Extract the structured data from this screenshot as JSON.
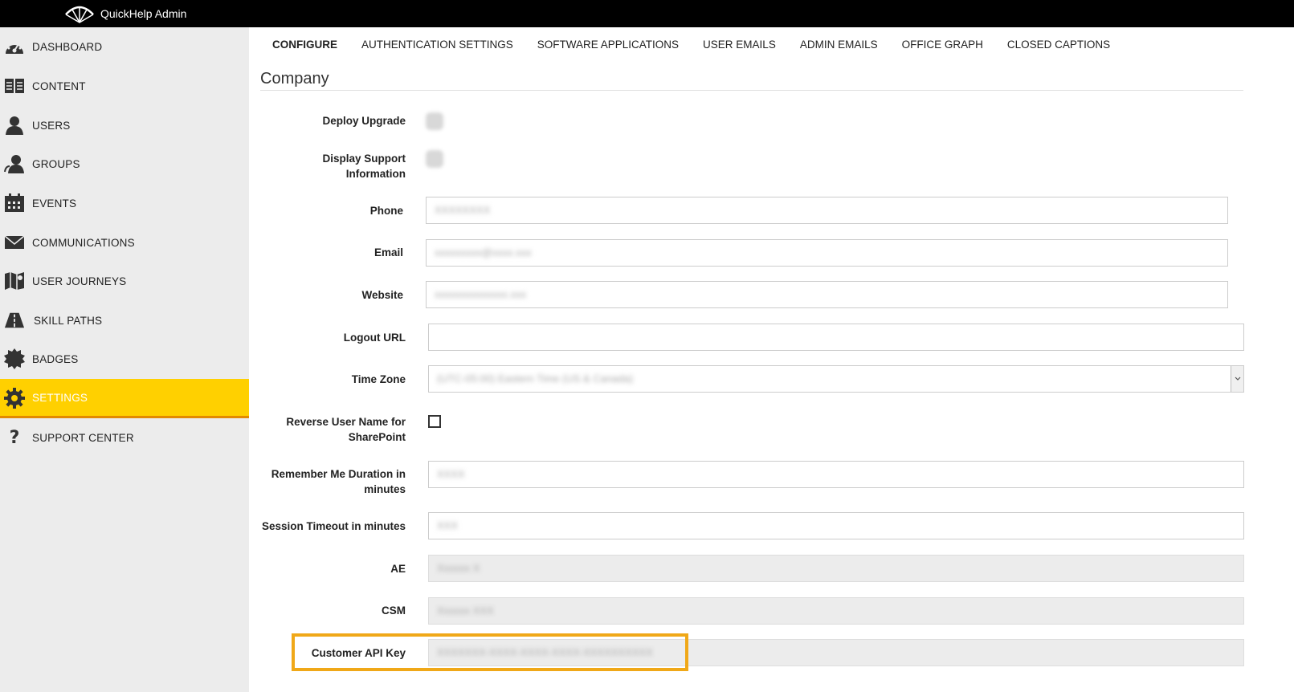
{
  "app": {
    "title": "QuickHelp Admin",
    "logo_icon": "parachute-logo-icon"
  },
  "sidebar": {
    "items": [
      {
        "label": "DASHBOARD",
        "icon": "speedometer-icon"
      },
      {
        "label": "CONTENT",
        "icon": "book-icon"
      },
      {
        "label": "USERS",
        "icon": "user-icon"
      },
      {
        "label": "GROUPS",
        "icon": "group-icon"
      },
      {
        "label": "EVENTS",
        "icon": "calendar-icon"
      },
      {
        "label": "COMMUNICATIONS",
        "icon": "envelope-icon"
      },
      {
        "label": "USER JOURNEYS",
        "icon": "map-icon"
      },
      {
        "label": "SKILL PATHS",
        "icon": "road-icon"
      },
      {
        "label": "BADGES",
        "icon": "badge-icon"
      },
      {
        "label": "SETTINGS",
        "icon": "gear-icon",
        "active": true
      },
      {
        "label": "SUPPORT CENTER",
        "icon": "question-icon"
      }
    ],
    "active_color": "#ffd000",
    "active_border": "#e38a00"
  },
  "tabs": [
    {
      "label": "CONFIGURE",
      "active": true
    },
    {
      "label": "AUTHENTICATION SETTINGS"
    },
    {
      "label": "SOFTWARE APPLICATIONS"
    },
    {
      "label": "USER EMAILS"
    },
    {
      "label": "ADMIN EMAILS"
    },
    {
      "label": "OFFICE GRAPH"
    },
    {
      "label": "CLOSED CAPTIONS"
    }
  ],
  "section": {
    "title": "Company"
  },
  "form": {
    "deploy_upgrade": {
      "label": "Deploy Upgrade"
    },
    "display_support": {
      "label_line1": "Display Support",
      "label_line2": "Information"
    },
    "phone": {
      "label": "Phone",
      "value": "XXXXXXXX"
    },
    "email": {
      "label": "Email",
      "value": "xxxxxxxxx@xxxx.xxx"
    },
    "website": {
      "label": "Website",
      "value": "xxxxxxxxxxxxxx.xxx"
    },
    "logout_url": {
      "label": "Logout URL",
      "value": ""
    },
    "time_zone": {
      "label": "Time Zone",
      "value": "(UTC-05:00) Eastern Time (US & Canada)"
    },
    "reverse_user_name": {
      "label_line1": "Reverse User Name for",
      "label_line2": "SharePoint",
      "checked": false
    },
    "remember_me": {
      "label_line1": "Remember Me Duration in",
      "label_line2": "minutes",
      "value": "XXXX"
    },
    "session_timeout": {
      "label": "Session Timeout in minutes",
      "value": "XXX"
    },
    "ae": {
      "label": "AE",
      "value": "Xxxxxx X"
    },
    "csm": {
      "label": "CSM",
      "value": "Xxxxxx XXX"
    },
    "customer_api_key": {
      "label": "Customer API Key",
      "value": "XXXXXXX-XXXX-XXXX-XXXX-XXXXXXXXXX"
    }
  },
  "highlight_color": "#f0a818"
}
